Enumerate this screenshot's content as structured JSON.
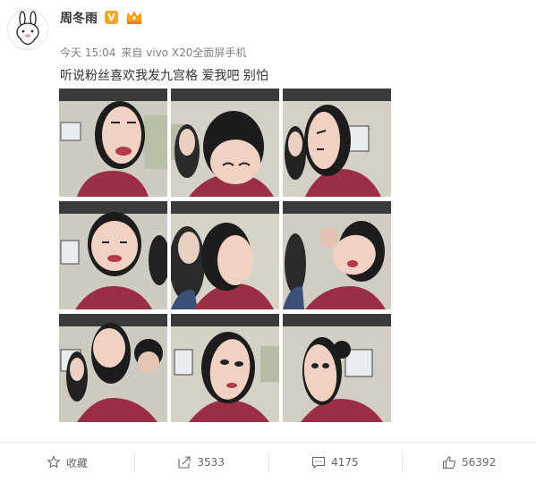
{
  "post": {
    "username": "周冬雨",
    "verified_badge": "V",
    "time": "今天 15:04",
    "source": "来自 vivo X20全面屏手机",
    "text": "听说粉丝喜欢我发九宫格 爱我吧 别怕",
    "photo_count": 9
  },
  "actions": {
    "favorite_label": "收藏",
    "repost_count": "3533",
    "comment_count": "4175",
    "like_count": "56392"
  },
  "colors": {
    "badge": "#f5a623",
    "hoodie": "#9a2f44",
    "hair": "#1c1c1c",
    "skin": "#f1d2c2"
  }
}
